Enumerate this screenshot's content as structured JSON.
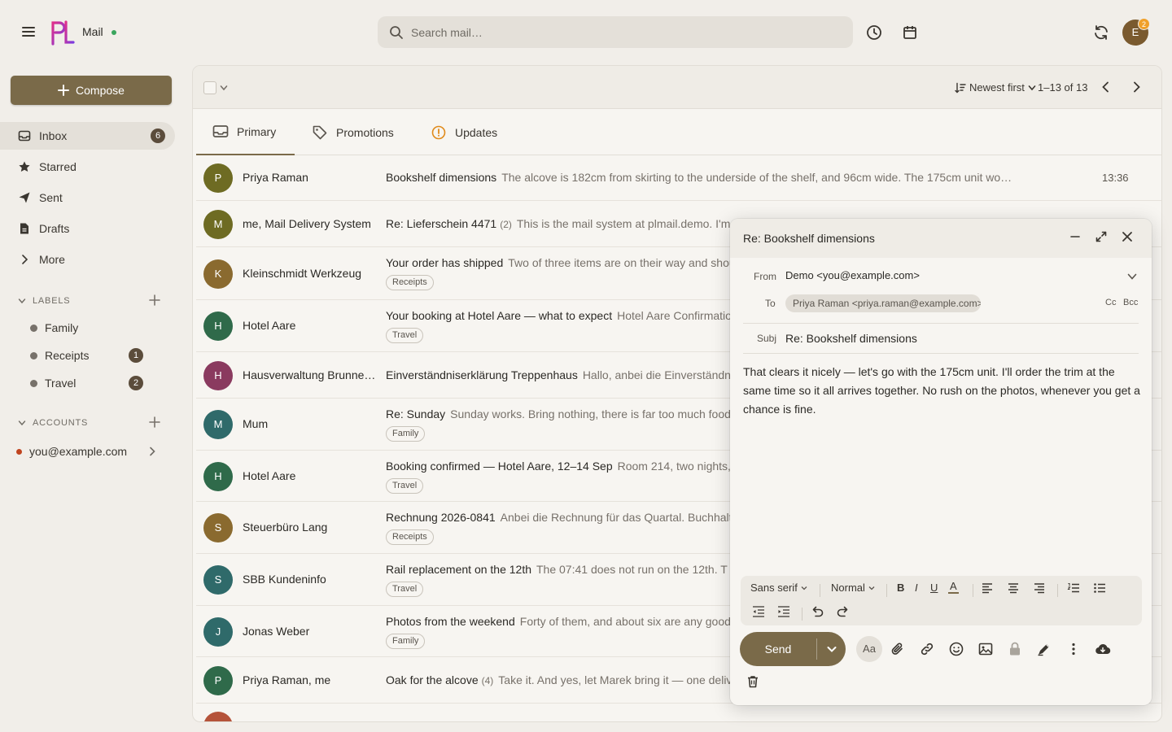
{
  "app": {
    "name": "Mail",
    "status_color": "#3aa55d"
  },
  "search": {
    "placeholder": "Search mail…"
  },
  "header": {
    "icons": [
      "menu-icon",
      "history-icon",
      "calendar-icon",
      "sync-icon"
    ],
    "avatar_initial": "E",
    "avatar_badge": "2"
  },
  "sidebar": {
    "compose_label": "Compose",
    "items": [
      {
        "label": "Inbox",
        "count": "6",
        "icon": "inbox-icon",
        "active": true
      },
      {
        "label": "Starred",
        "icon": "star-icon"
      },
      {
        "label": "Sent",
        "icon": "send-icon"
      },
      {
        "label": "Drafts",
        "icon": "draft-icon"
      },
      {
        "label": "More",
        "icon": "chevron-right-icon"
      }
    ],
    "labels_title": "LABELS",
    "labels": [
      {
        "name": "Family",
        "count": ""
      },
      {
        "name": "Receipts",
        "count": "1"
      },
      {
        "name": "Travel",
        "count": "2"
      }
    ],
    "accounts_title": "ACCOUNTS",
    "account": {
      "email": "you@example.com",
      "dot_color": "#c0441f"
    }
  },
  "toolbar": {
    "sort_label": "Newest first",
    "range": "1–13 of 13"
  },
  "tabs": [
    {
      "label": "Primary",
      "icon": "inbox-icon",
      "active": true
    },
    {
      "label": "Promotions",
      "icon": "tag-icon"
    },
    {
      "label": "Updates",
      "icon": "info-icon"
    }
  ],
  "emails": [
    {
      "initial": "P",
      "color": "#6e6b23",
      "sender": "Priya Raman",
      "subject": "Bookshelf dimensions",
      "thread": "",
      "snippet": "The alcove is 182cm from skirting to the underside of the shelf, and 96cm wide. The 175cm unit wo…",
      "chip": "",
      "time": "13:36"
    },
    {
      "initial": "M",
      "color": "#6e6b23",
      "sender": "me, Mail Delivery System",
      "subject": "Re: Lieferschein 4471",
      "thread": "(2)",
      "snippet": "This is the mail system at plmail.demo. I'm sorry to have to inform you that your message could not",
      "chip": "",
      "time": ""
    },
    {
      "initial": "K",
      "color": "#8a6a2f",
      "sender": "Kleinschmidt Werkzeug",
      "subject": "Your order has shipped",
      "thread": "",
      "snippet": "Two of three items are on their way and should arrive",
      "chip": "Receipts",
      "time": ""
    },
    {
      "initial": "H",
      "color": "#2f6a4a",
      "sender": "Hotel Aare",
      "subject": "Your booking at Hotel Aare — what to expect",
      "thread": "",
      "snippet": "Hotel Aare Confirmation",
      "chip": "Travel",
      "time": ""
    },
    {
      "initial": "H",
      "color": "#8a3a5f",
      "sender": "Hausverwaltung Brunnenhof",
      "subject": "Einverständniserklärung Treppenhaus",
      "thread": "",
      "snippet": "Hallo, anbei die Einverständniserklärung",
      "chip": "",
      "time": ""
    },
    {
      "initial": "M",
      "color": "#2f6a6a",
      "sender": "Mum",
      "subject": "Re: Sunday",
      "thread": "",
      "snippet": "Sunday works. Bring nothing, there is far too much food",
      "chip": "Family",
      "time": ""
    },
    {
      "initial": "H",
      "color": "#2f6a4a",
      "sender": "Hotel Aare",
      "subject": "Booking confirmed — Hotel Aare, 12–14 Sep",
      "thread": "",
      "snippet": "Room 214, two nights,",
      "chip": "Travel",
      "time": ""
    },
    {
      "initial": "S",
      "color": "#8a6a2f",
      "sender": "Steuerbüro Lang",
      "subject": "Rechnung 2026-0841",
      "thread": "",
      "snippet": "Anbei die Rechnung für das Quartal. Buchhaltung",
      "chip": "Receipts",
      "time": ""
    },
    {
      "initial": "S",
      "color": "#2f6a6a",
      "sender": "SBB Kundeninfo",
      "subject": "Rail replacement on the 12th",
      "thread": "",
      "snippet": "The 07:41 does not run on the 12th. T",
      "chip": "Travel",
      "time": ""
    },
    {
      "initial": "J",
      "color": "#2f6a6a",
      "sender": "Jonas Weber",
      "subject": "Photos from the weekend",
      "thread": "",
      "snippet": "Forty of them, and about six are any good.",
      "chip": "Family",
      "time": ""
    },
    {
      "initial": "P",
      "color": "#2f6a4a",
      "sender": "Priya Raman, me",
      "subject": "Oak for the alcove",
      "thread": "(4)",
      "snippet": "Take it. And yes, let Marek bring it — one delivery",
      "chip": "",
      "time": ""
    }
  ],
  "compose": {
    "title": "Re: Bookshelf dimensions",
    "from_label": "From",
    "from_value": "Demo <you@example.com>",
    "to_label": "To",
    "to_value": "Priya Raman <priya.raman@example.com>",
    "cc_label": "Cc",
    "bcc_label": "Bcc",
    "subj_label": "Subj",
    "subj_value": "Re: Bookshelf dimensions",
    "body": "That clears it nicely — let's go with the 175cm unit. I'll order the trim at the same time so it all arrives together. No rush on the photos, whenever you get a chance is fine.",
    "font_family": "Sans serif",
    "font_size": "Normal",
    "bold": "B",
    "italic": "I",
    "underline": "U",
    "text_color": "A",
    "send_label": "Send",
    "aa_label": "Aa",
    "accent": "#7a6a49"
  }
}
